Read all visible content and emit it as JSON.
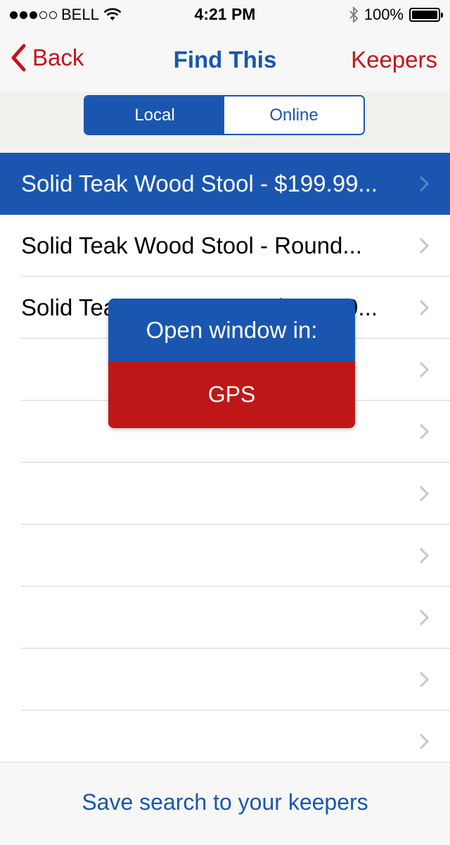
{
  "status_bar": {
    "carrier": "BELL",
    "time": "4:21 PM",
    "battery": "100%",
    "signal_bars_filled": 3,
    "signal_bars_total": 5
  },
  "nav": {
    "back_label": "Back",
    "title": "Find This",
    "keepers_label": "Keepers"
  },
  "segments": {
    "local": "Local",
    "online": "Online",
    "selected": "Local"
  },
  "results": [
    {
      "label": "Solid Teak Wood Stool - $199.99...",
      "selected": true
    },
    {
      "label": "Solid Teak Wood Stool - Round...",
      "selected": false
    },
    {
      "label": "Solid Teak Wood Stool - $599.99...",
      "selected": false
    },
    {
      "label": "",
      "selected": false
    },
    {
      "label": "",
      "selected": false
    },
    {
      "label": "",
      "selected": false
    },
    {
      "label": "",
      "selected": false
    },
    {
      "label": "",
      "selected": false
    },
    {
      "label": "",
      "selected": false
    },
    {
      "label": "",
      "selected": false
    }
  ],
  "popup": {
    "title": "Open window in:",
    "option": "GPS"
  },
  "footer": {
    "save_label": "Save search to your keepers"
  },
  "colors": {
    "brand_blue": "#1a56b0",
    "brand_red": "#c3151a",
    "popup_red": "#bf1718"
  },
  "icons": [
    "wifi-icon",
    "bluetooth-icon",
    "battery-icon",
    "back-chevron-icon",
    "chevron-right-icon"
  ]
}
